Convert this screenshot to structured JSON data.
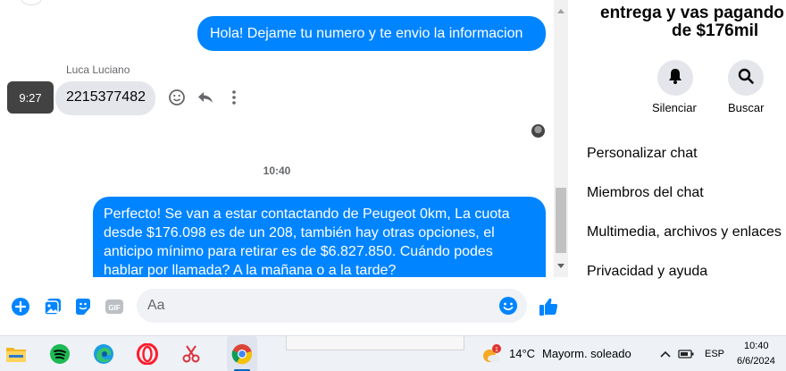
{
  "chat": {
    "outgoing_1": "Hola! Dejame tu numero y te envio la informacion",
    "sender_name": "Luca Luciano",
    "incoming_1": "2215377482",
    "hover_time": "9:27",
    "time_separator": "10:40",
    "outgoing_2": "Perfecto!  Se van a estar contactando de Peugeot 0km, La cuota desde $176.098 es de un 208, también hay otras opciones, el anticipo mínimo para retirar es de $6.827.850. Cuándo podes hablar por llamada? A la mañana o a la tarde?"
  },
  "composer": {
    "placeholder": "Aa"
  },
  "right_panel": {
    "title_line1": "entrega y vas pagando cu",
    "title_line2": "de $176mil",
    "mute_label": "Silenciar",
    "search_label": "Buscar",
    "menu": [
      "Personalizar chat",
      "Miembros del chat",
      "Multimedia, archivos y enlaces",
      "Privacidad y ayuda"
    ]
  },
  "taskbar": {
    "temperature": "14°C",
    "weather": "Mayorm. soleado",
    "weather_badge": "1",
    "language": "ESP",
    "time": "10:40",
    "date": "6/6/2024"
  },
  "colors": {
    "messenger_blue": "#0084ff",
    "incoming_bubble": "#e4e6eb"
  }
}
